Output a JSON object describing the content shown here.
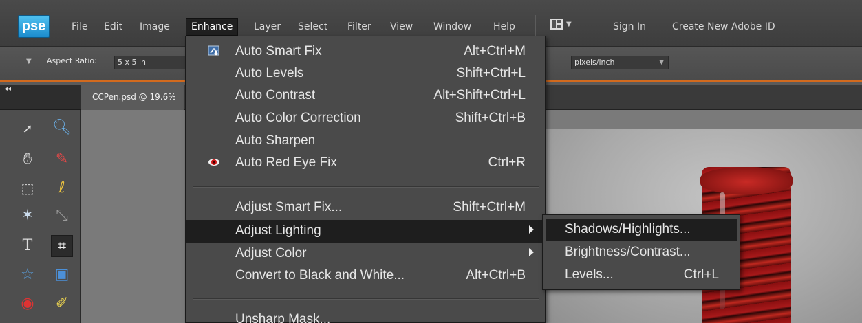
{
  "app": {
    "logo": "pse"
  },
  "menubar": {
    "items": [
      "File",
      "Edit",
      "Image",
      "Enhance",
      "Layer",
      "Select",
      "Filter",
      "View",
      "Window",
      "Help"
    ],
    "active": "Enhance",
    "sign_in": "Sign In",
    "create_id": "Create New Adobe ID"
  },
  "options_bar": {
    "aspect_label": "Aspect Ratio:",
    "aspect_value": "5 x 5 in",
    "resolution_units": "pixels/inch"
  },
  "document": {
    "tab_title": "CCPen.psd @ 19.6%"
  },
  "enhance_menu": {
    "items": [
      {
        "label": "Auto Smart Fix",
        "shortcut": "Alt+Ctrl+M",
        "icon": "smart-fix-icon"
      },
      {
        "label": "Auto Levels",
        "shortcut": "Shift+Ctrl+L"
      },
      {
        "label": "Auto Contrast",
        "shortcut": "Alt+Shift+Ctrl+L"
      },
      {
        "label": "Auto Color Correction",
        "shortcut": "Shift+Ctrl+B"
      },
      {
        "label": "Auto Sharpen",
        "shortcut": ""
      },
      {
        "label": "Auto Red Eye Fix",
        "shortcut": "Ctrl+R",
        "icon": "red-eye-icon"
      },
      {
        "label": "Adjust Smart Fix...",
        "shortcut": "Shift+Ctrl+M"
      },
      {
        "label": "Adjust Lighting",
        "shortcut": "",
        "submenu": true,
        "highlighted": true
      },
      {
        "label": "Adjust Color",
        "shortcut": "",
        "submenu": true
      },
      {
        "label": "Convert to Black and White...",
        "shortcut": "Alt+Ctrl+B"
      },
      {
        "label": "Unsharp Mask...",
        "shortcut": ""
      }
    ]
  },
  "adjust_lighting_submenu": {
    "items": [
      {
        "label": "Shadows/Highlights...",
        "shortcut": "",
        "highlighted": true
      },
      {
        "label": "Brightness/Contrast...",
        "shortcut": ""
      },
      {
        "label": "Levels...",
        "shortcut": "Ctrl+L"
      }
    ]
  },
  "colors": {
    "accent_bar": "#d26a1e",
    "highlight": "#1e1e1e",
    "logo_blue": "#2ea2e0"
  }
}
